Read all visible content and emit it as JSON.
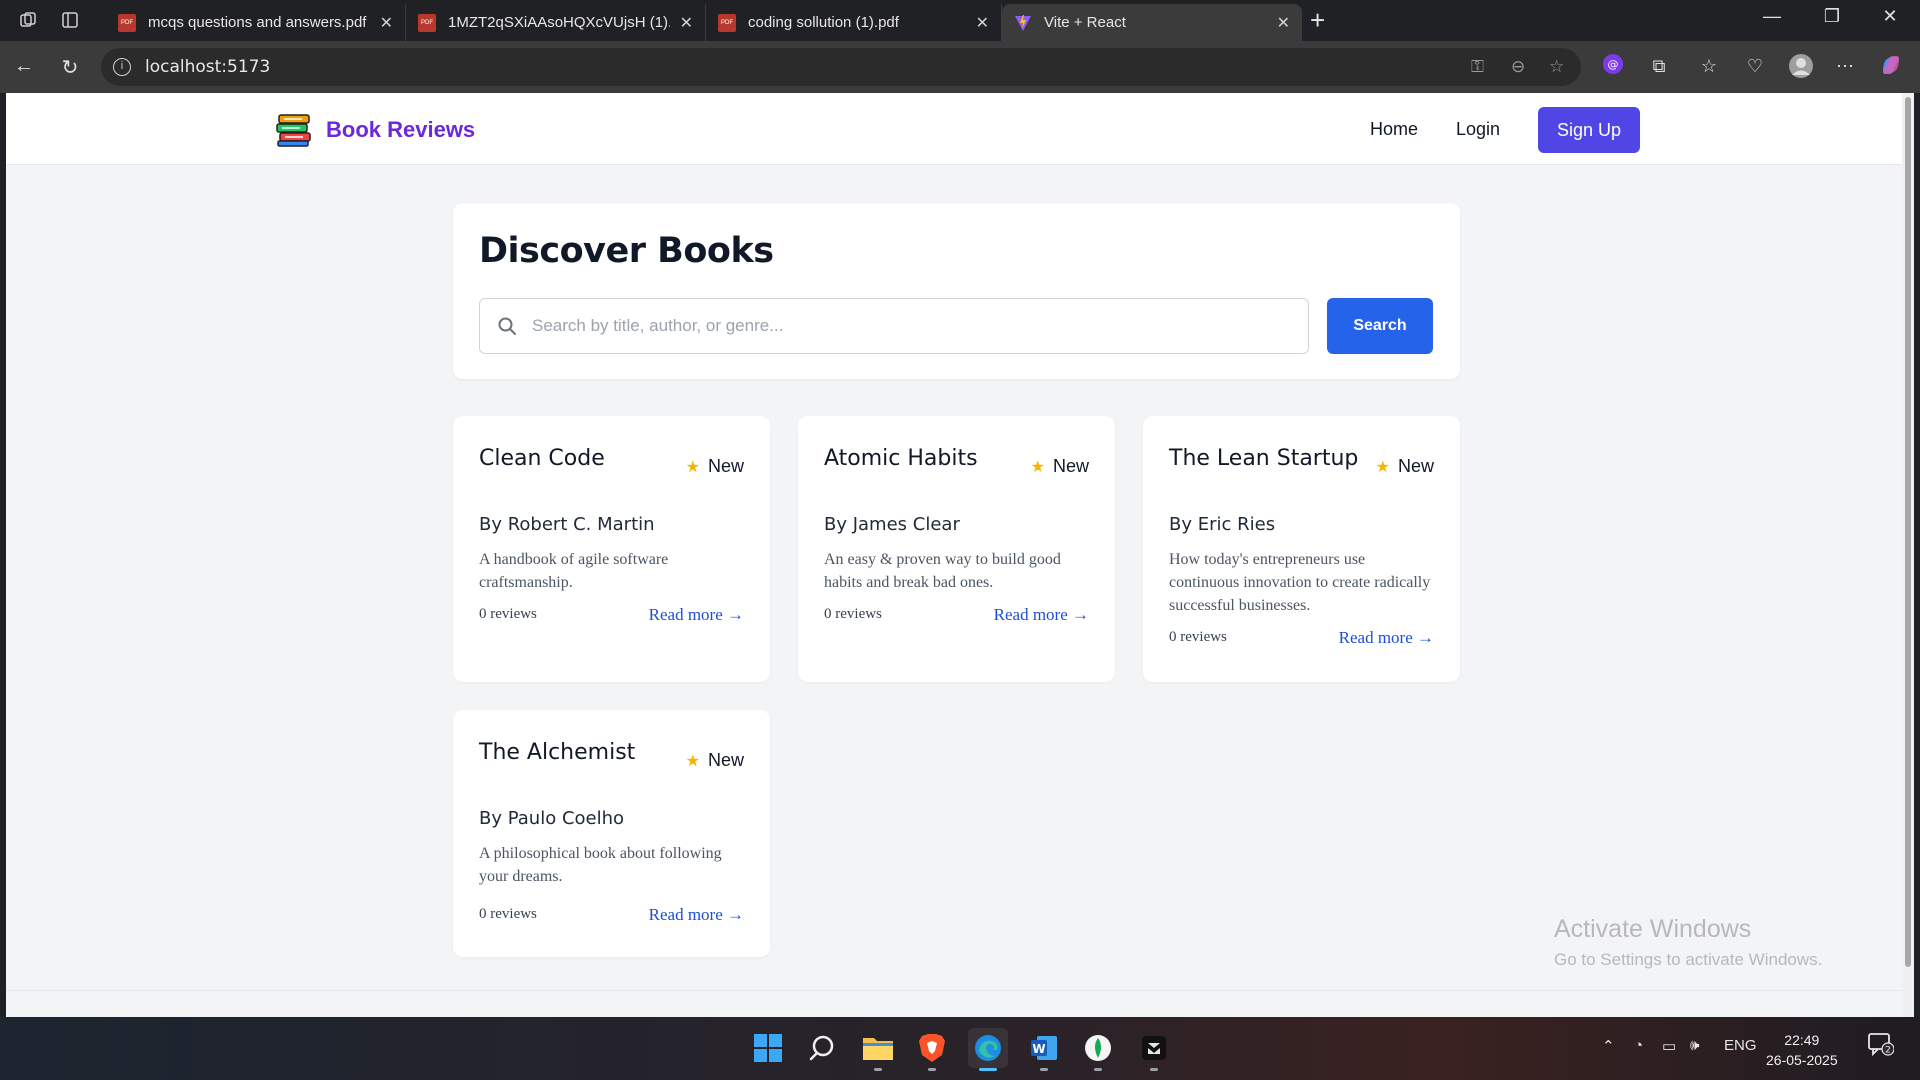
{
  "browser": {
    "tabs": [
      {
        "title": "mcqs questions and answers.pdf",
        "type": "pdf"
      },
      {
        "title": "1MZT2qSXiAAsoHQXcVUjsH (1).p",
        "type": "pdf"
      },
      {
        "title": "coding sollution (1).pdf",
        "type": "pdf"
      },
      {
        "title": "Vite + React",
        "type": "vite",
        "active": true
      }
    ],
    "url": "localhost:5173"
  },
  "app": {
    "brand": "Book Reviews",
    "nav": {
      "home": "Home",
      "login": "Login",
      "signup": "Sign Up"
    },
    "page_title": "Discover Books",
    "search": {
      "placeholder": "Search by title, author, or genre...",
      "value": "",
      "button": "Search"
    },
    "books": [
      {
        "title": "Clean Code",
        "rating": "New",
        "author": "By Robert C. Martin",
        "description": "A handbook of agile software craftsmanship.",
        "reviews": "0 reviews",
        "link": "Read more →"
      },
      {
        "title": "Atomic Habits",
        "rating": "New",
        "author": "By James Clear",
        "description": "An easy & proven way to build good habits and break bad ones.",
        "reviews": "0 reviews",
        "link": "Read more →"
      },
      {
        "title": "The Lean Startup",
        "rating": "New",
        "author": "By Eric Ries",
        "description": "How today's entrepreneurs use continuous innovation to create radically successful businesses.",
        "reviews": "0 reviews",
        "link": "Read more →"
      },
      {
        "title": "The Alchemist",
        "rating": "New",
        "author": "By Paulo Coelho",
        "description": "A philosophical book about following your dreams.",
        "reviews": "0 reviews",
        "link": "Read more →"
      }
    ]
  },
  "watermark": {
    "line1": "Activate Windows",
    "line2": "Go to Settings to activate Windows."
  },
  "taskbar": {
    "language": "ENG",
    "time": "22:49",
    "date": "26-05-2025",
    "notifications": "2"
  },
  "colors": {
    "brand": "#6d28d9",
    "signup": "#4f46e5",
    "search_button": "#2563eb",
    "link": "#1d4ed8",
    "star": "#f5b400"
  }
}
